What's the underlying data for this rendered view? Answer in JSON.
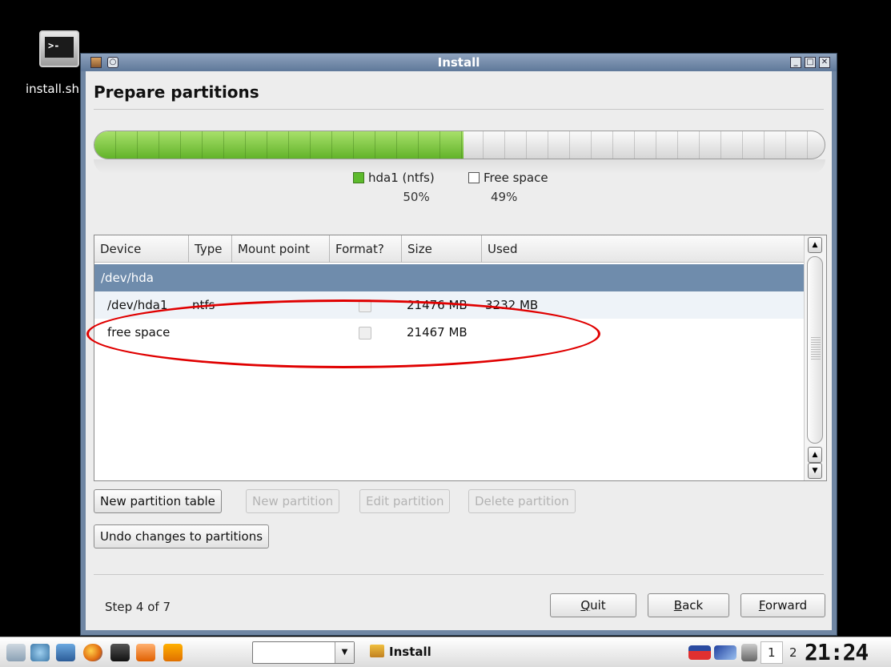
{
  "desktop": {
    "icon_label": "install.sh"
  },
  "window": {
    "title": "Install"
  },
  "page": {
    "title": "Prepare partitions"
  },
  "partition_bar": {
    "used_fraction": 0.505,
    "legend": [
      {
        "name": "hda1 (ntfs)",
        "percent": "50%",
        "color": "#5dba2c"
      },
      {
        "name": "Free space",
        "percent": "49%",
        "color": "#ffffff"
      }
    ]
  },
  "table": {
    "columns": [
      "Device",
      "Type",
      "Mount point",
      "Format?",
      "Size",
      "Used"
    ],
    "rows": [
      {
        "device": "/dev/hda",
        "type": "",
        "mount": "",
        "size": "",
        "used": ""
      },
      {
        "device": "/dev/hda1",
        "type": "ntfs",
        "mount": "",
        "size": "21476 MB",
        "used": "3232 MB"
      },
      {
        "device": "free space",
        "type": "",
        "mount": "",
        "size": "21467 MB",
        "used": ""
      }
    ]
  },
  "buttons": {
    "new_table": "New partition table",
    "new_partition": "New partition",
    "edit_partition": "Edit partition",
    "delete_partition": "Delete partition",
    "undo": "Undo changes to partitions",
    "quit": "Quit",
    "back": "Back",
    "forward": "Forward"
  },
  "footer": {
    "step": "Step 4 of 7"
  },
  "taskbar": {
    "task": "Install",
    "workspaces": [
      "1",
      "2"
    ],
    "clock": "21:24"
  },
  "colors": {
    "accent": "#e00000",
    "selection": "#6f8cac",
    "bar_green": "#62b32a"
  }
}
